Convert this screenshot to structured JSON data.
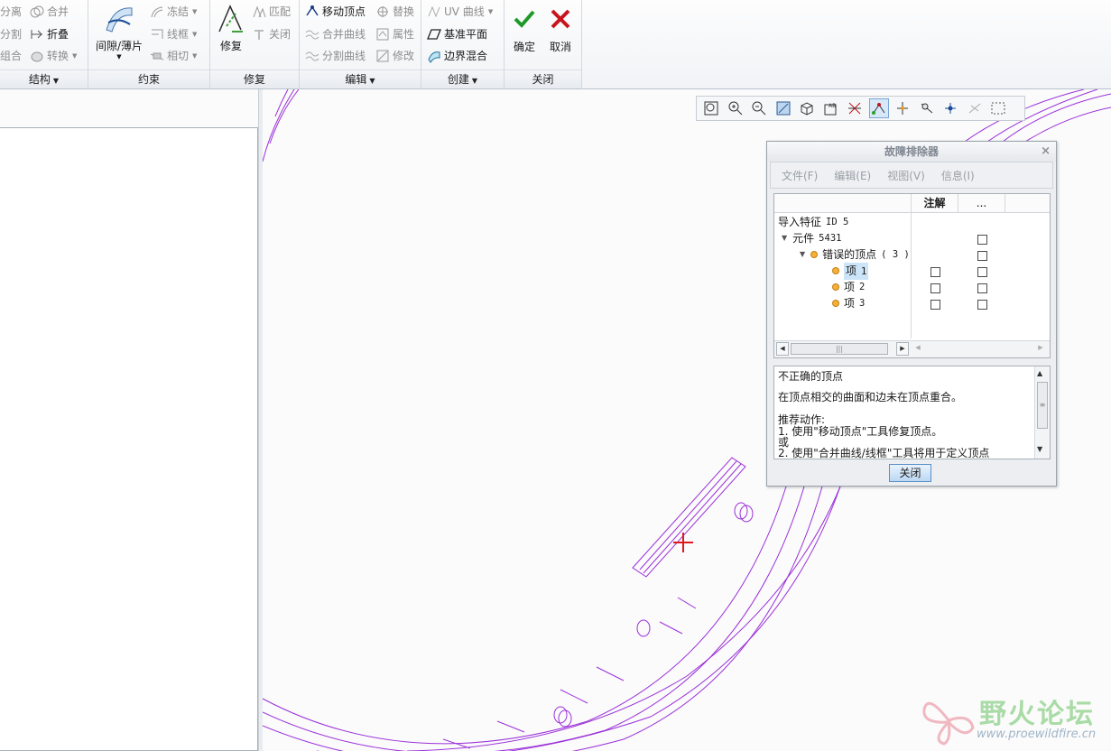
{
  "ribbon": {
    "group1": {
      "label": "结构",
      "items": [
        "分离",
        "分割",
        "组合",
        "合并",
        "折叠",
        "转换"
      ]
    },
    "group2": {
      "label": "约束",
      "big": "间隙/薄片",
      "items": [
        "冻结",
        "线框",
        "相切"
      ]
    },
    "group3": {
      "label": "修复",
      "big": "修复",
      "items": [
        "匹配",
        "关闭"
      ]
    },
    "group4": {
      "label": "编辑",
      "items": [
        "移动顶点",
        "合并曲线",
        "分割曲线",
        "替换",
        "属性",
        "修改"
      ]
    },
    "group5": {
      "label": "创建",
      "items": [
        "UV 曲线",
        "基准平面",
        "边界混合"
      ]
    },
    "group6": {
      "label": "关闭",
      "ok": "确定",
      "cancel": "取消"
    }
  },
  "dialog": {
    "title": "故障排除器",
    "menu": [
      "文件(F)",
      "编辑(E)",
      "视图(V)",
      "信息(I)"
    ],
    "columns": [
      "注解",
      "..."
    ],
    "rows": [
      {
        "label": "导入特征",
        "id": "ID 5"
      },
      {
        "label": "元件",
        "id": "5431"
      },
      {
        "label": "错误的顶点",
        "id": "( 3 )"
      },
      {
        "label": "项",
        "id": "1"
      },
      {
        "label": "项",
        "id": "2"
      },
      {
        "label": "项",
        "id": "3"
      }
    ],
    "message": {
      "title": "不正确的顶点",
      "desc": "在顶点相交的曲面和边未在顶点重合。",
      "rec": "推荐动作:",
      "step1": "1.  使用\"移动顶点\"工具修复顶点。",
      "or": "或",
      "step2": "2.  使用\"合并曲线/线框\"工具将用于定义顶点"
    },
    "close": "关闭"
  },
  "watermark": {
    "text": "野火论坛",
    "url": "www.proewildfire.cn"
  },
  "colors": {
    "wireframe": "#9b30d9",
    "ok": "#1e9a2a",
    "cancel": "#c8141c",
    "highlight": "#cce4f7"
  }
}
